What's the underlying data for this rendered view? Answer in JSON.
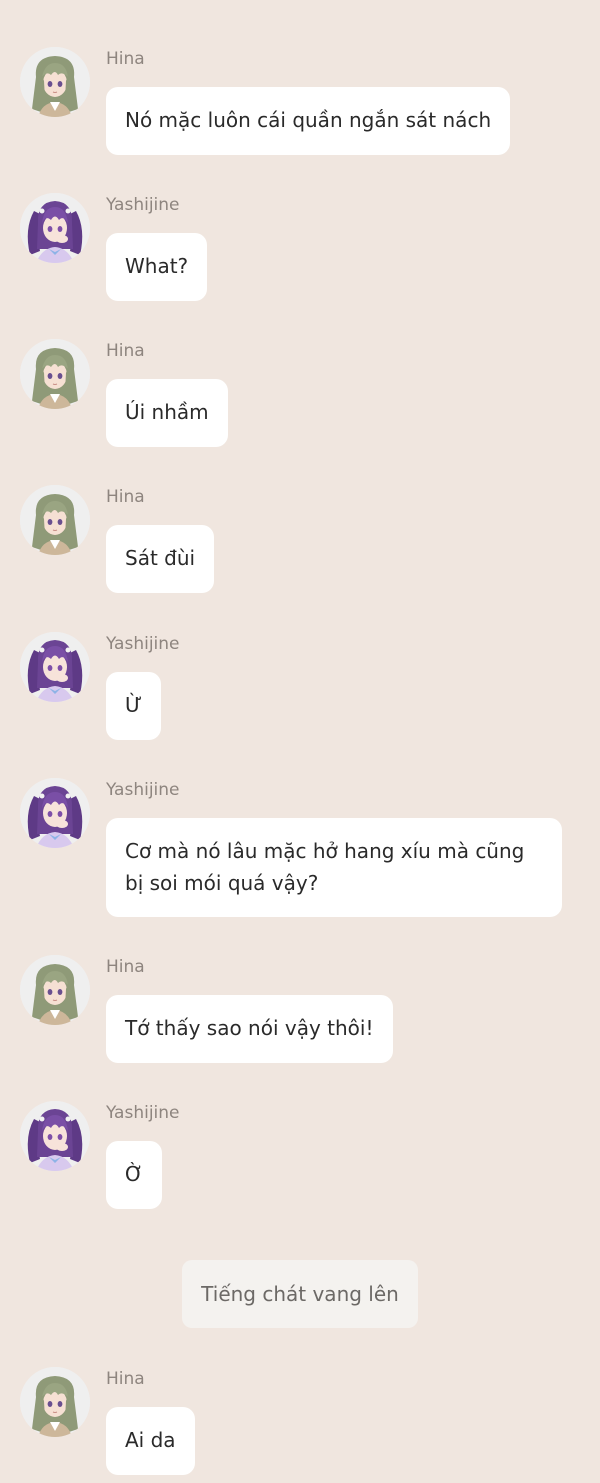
{
  "colors": {
    "background": "#F0E6DF",
    "bubble": "#FFFFFF",
    "sender_name": "#8E857F",
    "system_bubble": "#F4F2EF"
  },
  "messages": [
    {
      "sender": "Hina",
      "text": "Nó mặc luôn cái quần ngắn sát nách",
      "avatar": "hina-avatar"
    },
    {
      "sender": "Yashijine",
      "text": "What?",
      "avatar": "yashijine-avatar"
    },
    {
      "sender": "Hina",
      "text": "Úi nhầm",
      "avatar": "hina-avatar"
    },
    {
      "sender": "Hina",
      "text": "Sát đùi",
      "avatar": "hina-avatar"
    },
    {
      "sender": "Yashijine",
      "text": "Ừ",
      "avatar": "yashijine-avatar"
    },
    {
      "sender": "Yashijine",
      "text": "Cơ mà nó lâu mặc hở hang xíu mà cũng bị soi mói quá vậy?",
      "avatar": "yashijine-avatar"
    },
    {
      "sender": "Hina",
      "text": "Tớ thấy sao nói vậy thôi!",
      "avatar": "hina-avatar"
    },
    {
      "sender": "Yashijine",
      "text": "Ờ",
      "avatar": "yashijine-avatar"
    },
    {
      "sender": "Hina",
      "text": "Ai da",
      "avatar": "hina-avatar"
    }
  ],
  "system_message": "Tiếng chát vang lên"
}
